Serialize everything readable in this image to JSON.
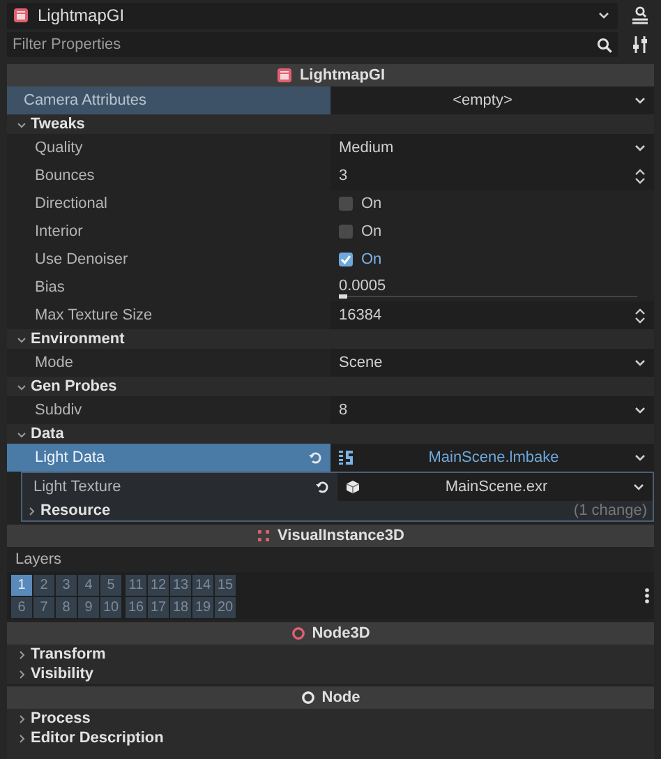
{
  "node_selector": {
    "name": "LightmapGI"
  },
  "filter": {
    "placeholder": "Filter Properties"
  },
  "sections": [
    {
      "title": "LightmapGI",
      "rows": [
        {
          "kind": "resource",
          "label": "Camera Attributes",
          "value": "<empty>",
          "hovered": true,
          "selected": false
        },
        {
          "kind": "group",
          "label": "Tweaks",
          "expanded": true,
          "rows": [
            {
              "kind": "dropdown",
              "label": "Quality",
              "value": "Medium",
              "hovered": false,
              "selected": false
            },
            {
              "kind": "spin",
              "label": "Bounces",
              "value": "3",
              "hovered": false,
              "selected": false
            },
            {
              "kind": "check",
              "label": "Directional",
              "value": "On",
              "checked": false,
              "hovered": false,
              "selected": false
            },
            {
              "kind": "check",
              "label": "Interior",
              "value": "On",
              "checked": false,
              "hovered": false,
              "selected": false
            },
            {
              "kind": "check",
              "label": "Use Denoiser",
              "value": "On",
              "checked": true,
              "hovered": false,
              "selected": false
            },
            {
              "kind": "slider",
              "label": "Bias",
              "value": "0.0005",
              "level": 0.01,
              "hovered": false,
              "selected": false
            },
            {
              "kind": "spin",
              "label": "Max Texture Size",
              "value": "16384",
              "hovered": false,
              "selected": false
            }
          ]
        },
        {
          "kind": "group",
          "label": "Environment",
          "expanded": true,
          "rows": [
            {
              "kind": "dropdown",
              "label": "Mode",
              "value": "Scene",
              "hovered": false,
              "selected": false
            }
          ]
        },
        {
          "kind": "group",
          "label": "Gen Probes",
          "expanded": true,
          "rows": [
            {
              "kind": "dropdown",
              "label": "Subdiv",
              "value": "8",
              "hovered": false,
              "selected": false
            }
          ]
        },
        {
          "kind": "group",
          "label": "Data",
          "expanded": true,
          "rows": [
            {
              "kind": "resource",
              "label": "Light Data",
              "value": "MainScene.lmbake",
              "revertable": true,
              "hovered": false,
              "selected": true,
              "subresource": {
                "rows": [
                  {
                    "kind": "resource",
                    "label": "Light Texture",
                    "value": "MainScene.exr",
                    "revertable": true,
                    "hovered": false,
                    "selected": false
                  },
                  {
                    "kind": "group",
                    "label": "Resource",
                    "expanded": false,
                    "note": "(1 change)",
                    "rows": []
                  }
                ]
              }
            }
          ]
        }
      ]
    },
    {
      "title": "VisualInstance3D",
      "rows": [
        {
          "kind": "layers",
          "label": "Layers",
          "blocks": [
            [
              {
                "label": "1",
                "on": true
              },
              {
                "label": "2",
                "on": false
              },
              {
                "label": "3",
                "on": false
              },
              {
                "label": "4",
                "on": false
              },
              {
                "label": "5",
                "on": false
              },
              {
                "label": "6",
                "on": false
              },
              {
                "label": "7",
                "on": false
              },
              {
                "label": "8",
                "on": false
              },
              {
                "label": "9",
                "on": false
              },
              {
                "label": "10",
                "on": false
              }
            ],
            [
              {
                "label": "11",
                "on": false
              },
              {
                "label": "12",
                "on": false
              },
              {
                "label": "13",
                "on": false
              },
              {
                "label": "14",
                "on": false
              },
              {
                "label": "15",
                "on": false
              },
              {
                "label": "16",
                "on": false
              },
              {
                "label": "17",
                "on": false
              },
              {
                "label": "18",
                "on": false
              },
              {
                "label": "19",
                "on": false
              },
              {
                "label": "20",
                "on": false
              }
            ]
          ]
        }
      ]
    },
    {
      "title": "Node3D",
      "rows": [
        {
          "kind": "group",
          "label": "Transform",
          "expanded": false,
          "rows": []
        },
        {
          "kind": "group",
          "label": "Visibility",
          "expanded": false,
          "rows": []
        }
      ]
    },
    {
      "title": "Node",
      "rows": [
        {
          "kind": "group",
          "label": "Process",
          "expanded": false,
          "rows": []
        },
        {
          "kind": "group",
          "label": "Editor Description",
          "expanded": false,
          "rows": []
        }
      ]
    }
  ]
}
